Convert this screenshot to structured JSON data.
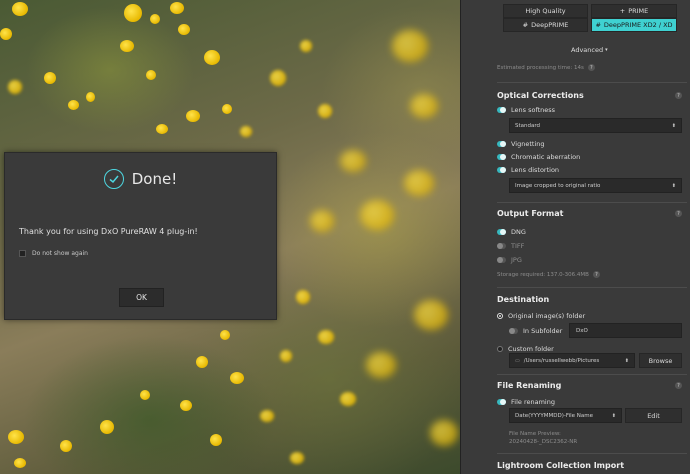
{
  "dialog": {
    "title": "Done!",
    "message": "Thank you for using DxO PureRAW 4 plug-in!",
    "checkbox_label": "Do not show again",
    "ok_label": "OK"
  },
  "processing": {
    "buttons": [
      {
        "label": "High Quality",
        "icon": "",
        "active": false
      },
      {
        "label": "PRIME",
        "icon": "+",
        "active": false
      },
      {
        "label": "DeepPRIME",
        "icon": "#",
        "active": false
      },
      {
        "label": "DeepPRIME XD2 / XD",
        "icon": "#",
        "active": true
      }
    ],
    "advanced_label": "Advanced",
    "estimated_time": "Estimated processing time: 14s"
  },
  "optical": {
    "title": "Optical Corrections",
    "lens_softness": {
      "label": "Lens softness",
      "on": true
    },
    "softness_select": "Standard",
    "vignetting": {
      "label": "Vignetting",
      "on": true
    },
    "chromatic": {
      "label": "Chromatic aberration",
      "on": true
    },
    "distortion": {
      "label": "Lens distortion",
      "on": true
    },
    "distortion_select": "Image cropped to original ratio"
  },
  "output": {
    "title": "Output Format",
    "formats": [
      {
        "label": "DNG",
        "on": true
      },
      {
        "label": "TIFF",
        "on": false
      },
      {
        "label": "JPG",
        "on": false
      }
    ],
    "storage": "Storage required: 137.0-306.4MB"
  },
  "destination": {
    "title": "Destination",
    "original_folder": "Original image(s) folder",
    "in_subfolder": "In Subfolder",
    "subfolder_value": "DxO",
    "custom_folder": "Custom folder",
    "custom_path": "/Users/russellwebb/Pictures",
    "browse_label": "Browse"
  },
  "renaming": {
    "title": "File Renaming",
    "toggle_label": "File renaming",
    "pattern": "Date(YYYYMMDD)-File Name",
    "edit_label": "Edit",
    "preview_label": "File Name Preview:",
    "preview_value": "20240428-_DSC2362-NR"
  },
  "lightroom": {
    "title": "Lightroom Collection Import"
  }
}
